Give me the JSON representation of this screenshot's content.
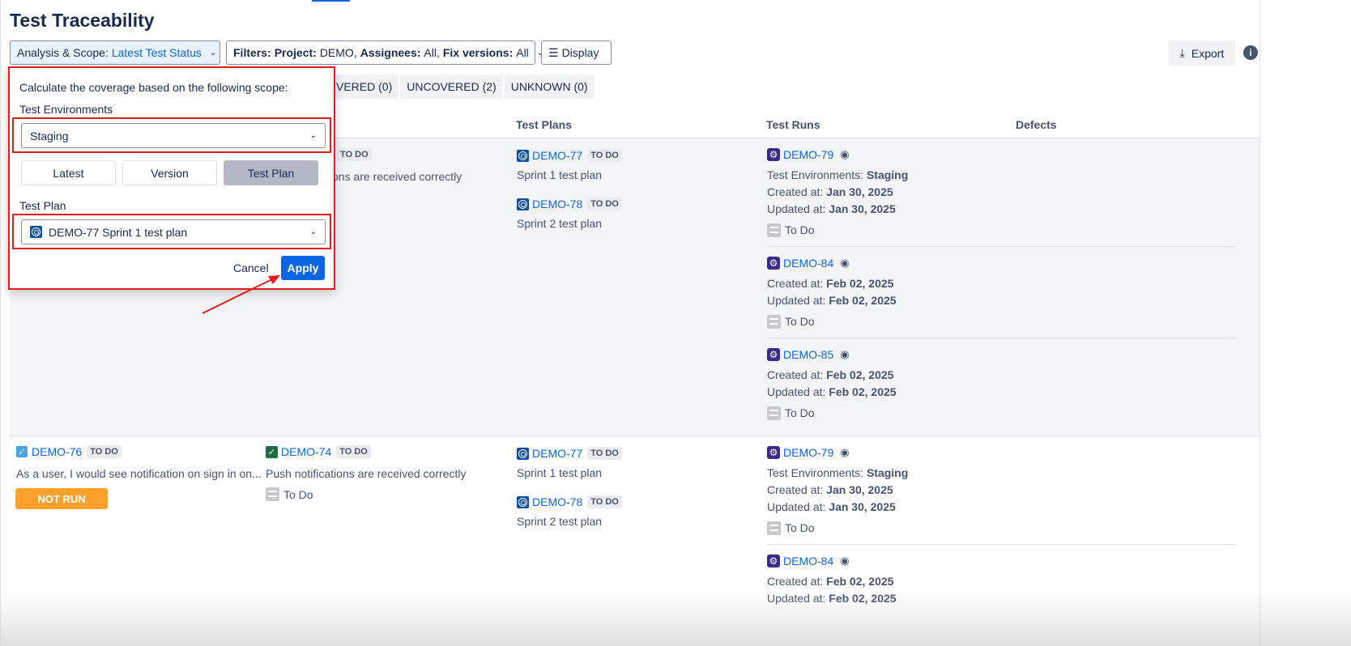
{
  "title": "Test Traceability",
  "toolbar": {
    "analysis_label": "Analysis & Scope:",
    "analysis_value": "Latest Test Status",
    "filters_label": "Filters:",
    "project_label": "Project:",
    "project_value": "DEMO,",
    "assignees_label": "Assignees:",
    "assignees_value": "All,",
    "fixversions_label": "Fix versions:",
    "fixversions_value": "All",
    "display_label": "Display",
    "export_label": "Export"
  },
  "tabs": [
    "VERED (0)",
    "UNCOVERED (2)",
    "UNKNOWN (0)"
  ],
  "columns": {
    "test_plans": "Test Plans",
    "test_runs": "Test Runs",
    "defects": "Defects"
  },
  "popover": {
    "intro": "Calculate the coverage based on the following scope:",
    "env_label": "Test Environments",
    "env_value": "Staging",
    "scope_options": [
      "Latest",
      "Version",
      "Test Plan"
    ],
    "scope_selected": "Test Plan",
    "plan_label": "Test Plan",
    "plan_value": "DEMO-77 Sprint 1 test plan",
    "cancel": "Cancel",
    "apply": "Apply"
  },
  "rows": [
    {
      "test_badge": "TO DO",
      "test_summary_partial": "ons are received correctly",
      "plans": [
        {
          "key": "DEMO-77",
          "status": "TO DO",
          "name": "Sprint 1 test plan"
        },
        {
          "key": "DEMO-78",
          "status": "TO DO",
          "name": "Sprint 2 test plan"
        }
      ],
      "runs": [
        {
          "key": "DEMO-79",
          "env": "Staging",
          "created": "Jan 30, 2025",
          "updated": "Jan 30, 2025",
          "status": "To Do"
        },
        {
          "key": "DEMO-84",
          "created": "Feb 02, 2025",
          "updated": "Feb 02, 2025",
          "status": "To Do"
        },
        {
          "key": "DEMO-85",
          "created": "Feb 02, 2025",
          "updated": "Feb 02, 2025",
          "status": "To Do"
        }
      ]
    },
    {
      "req_key": "DEMO-76",
      "req_status": "TO DO",
      "req_summary": "As a user, I would see notification on sign in on...",
      "coverage": "NOT RUN",
      "test_key": "DEMO-74",
      "test_status": "TO DO",
      "test_summary": "Push notifications are received correctly",
      "test_run_status": "To Do",
      "plans": [
        {
          "key": "DEMO-77",
          "status": "TO DO",
          "name": "Sprint 1 test plan"
        },
        {
          "key": "DEMO-78",
          "status": "TO DO",
          "name": "Sprint 2 test plan"
        }
      ],
      "runs": [
        {
          "key": "DEMO-79",
          "env": "Staging",
          "created": "Jan 30, 2025",
          "updated": "Jan 30, 2025",
          "status": "To Do"
        },
        {
          "key": "DEMO-84",
          "created": "Feb 02, 2025",
          "updated": "Feb 02, 2025"
        }
      ]
    }
  ],
  "labels": {
    "env": "Test Environments:",
    "created": "Created at:",
    "updated": "Updated at:"
  },
  "colors": {
    "accent": "#0c66e4",
    "annotation": "#e51c1c",
    "not_run": "#ffa12b"
  }
}
